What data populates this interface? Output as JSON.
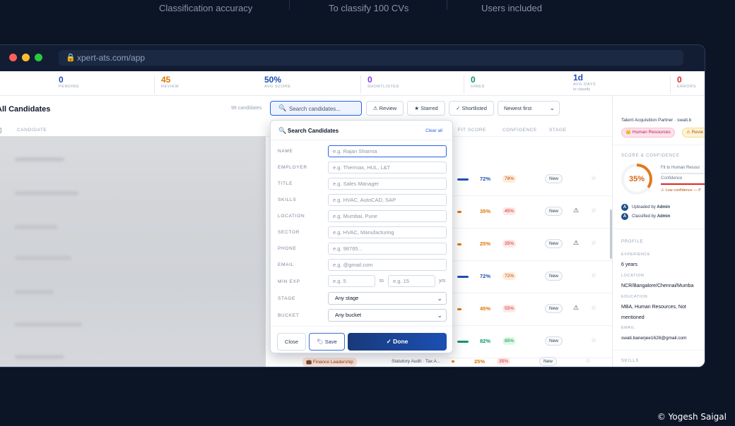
{
  "top_stats": [
    "Classification accuracy",
    "To classify 100 CVs",
    "Users included"
  ],
  "browser": {
    "url": "xpert-ats.com/app"
  },
  "stats": [
    {
      "value": "0",
      "label": "PENDING",
      "color": "#1e4fb3"
    },
    {
      "value": "45",
      "label": "REVIEW",
      "color": "#d97706"
    },
    {
      "value": "50%",
      "label": "AVG SCORE",
      "color": "#1e4fb3"
    },
    {
      "value": "0",
      "label": "SHORTLISTED",
      "color": "#7c3aed"
    },
    {
      "value": "0",
      "label": "HIRED",
      "color": "#059669"
    },
    {
      "value": "1d",
      "label": "AVG DAYS",
      "sub": "to classify",
      "color": "#1e4fb3"
    },
    {
      "value": "0",
      "label": "ERRORS",
      "color": "#dc2626"
    }
  ],
  "list": {
    "title": "All Candidates",
    "count": "98 candidates",
    "search_placeholder": "Search candidates...",
    "filters": [
      "⚠ Review",
      "★ Starred",
      "✓ Shortlisted"
    ],
    "sort": "Newest first",
    "columns": {
      "candidate": "CANDIDATE",
      "fit": "FIT SCORE",
      "confidence": "CONFIDENCE",
      "stage": "STAGE"
    }
  },
  "rows": [
    {
      "score": "72%",
      "conf": "78%",
      "stage": "New",
      "warn": false,
      "fill": 0.72,
      "color": "#1e4fb3"
    },
    {
      "score": "35%",
      "conf": "45%",
      "stage": "New",
      "warn": true,
      "fill": 0.35,
      "color": "#d97706"
    },
    {
      "score": "25%",
      "conf": "35%",
      "stage": "New",
      "warn": true,
      "fill": 0.25,
      "color": "#d97706"
    },
    {
      "score": "72%",
      "conf": "72%",
      "stage": "New",
      "warn": false,
      "fill": 0.72,
      "color": "#1e4fb3"
    },
    {
      "score": "45%",
      "conf": "55%",
      "stage": "New",
      "warn": true,
      "fill": 0.45,
      "color": "#d97706"
    },
    {
      "score": "82%",
      "conf": "85%",
      "stage": "New",
      "warn": false,
      "fill": 0.82,
      "color": "#059669"
    }
  ],
  "last_row": {
    "tag": "💼 Finance Leadership",
    "title": "Statutory Audit · Tax A...",
    "score": "25%",
    "conf": "35%",
    "stage": "New"
  },
  "modal": {
    "title": "Search Candidates",
    "clear": "Clear all",
    "fields": [
      {
        "label": "NAME",
        "placeholder": "e.g. Rajan Sharma"
      },
      {
        "label": "EMPLOYER",
        "placeholder": "e.g. Thermax, HUL, L&T"
      },
      {
        "label": "TITLE",
        "placeholder": "e.g. Sales Manager"
      },
      {
        "label": "SKILLS",
        "placeholder": "e.g. HVAC, AutoCAD, SAP"
      },
      {
        "label": "LOCATION",
        "placeholder": "e.g. Mumbai, Pune"
      },
      {
        "label": "SECTOR",
        "placeholder": "e.g. HVAC, Manufacturing"
      },
      {
        "label": "PHONE",
        "placeholder": "e.g. 98765..."
      },
      {
        "label": "EMAIL",
        "placeholder": "e.g. @gmail.com"
      }
    ],
    "min_exp": {
      "label": "MIN EXP",
      "from": "e.g. 5",
      "to_label": "to",
      "to": "e.g. 15",
      "unit": "yrs"
    },
    "stage": {
      "label": "STAGE",
      "value": "Any stage"
    },
    "bucket": {
      "label": "BUCKET",
      "value": "Any bucket"
    },
    "buttons": {
      "close": "Close",
      "save": "🏷 Save",
      "done": "✓ Done"
    }
  },
  "panel": {
    "headline": "Talent Acquisition Partner · swati.b",
    "tags": [
      "👑 Human Resources",
      "⚠ Revie"
    ],
    "score_section": "SCORE & CONFIDENCE",
    "score": "35%",
    "score_fraction": 0.35,
    "fit_line": "Fit to Human Resour",
    "confidence_label": "Confidence",
    "low_conf": "⚠ Low confidence — P",
    "uploaded": {
      "text": "Uploaded by ",
      "user": "Admin"
    },
    "classified": {
      "text": "Classified by ",
      "user": "Admin"
    },
    "profile_section": "PROFILE",
    "experience": {
      "label": "EXPERIENCE",
      "value": "6 years"
    },
    "location": {
      "label": "LOCATION",
      "value": "NCR/Bangalore/Chennai/Mumba"
    },
    "education": {
      "label": "EDUCATION",
      "line1": "MBA, Human Resources, Not",
      "line2": "mentioned"
    },
    "email": {
      "label": "EMAIL",
      "value": "swati.banerjee1628@gmail.com"
    },
    "skills_section": "SKILLS"
  },
  "copyright": "© Yogesh Saigal"
}
